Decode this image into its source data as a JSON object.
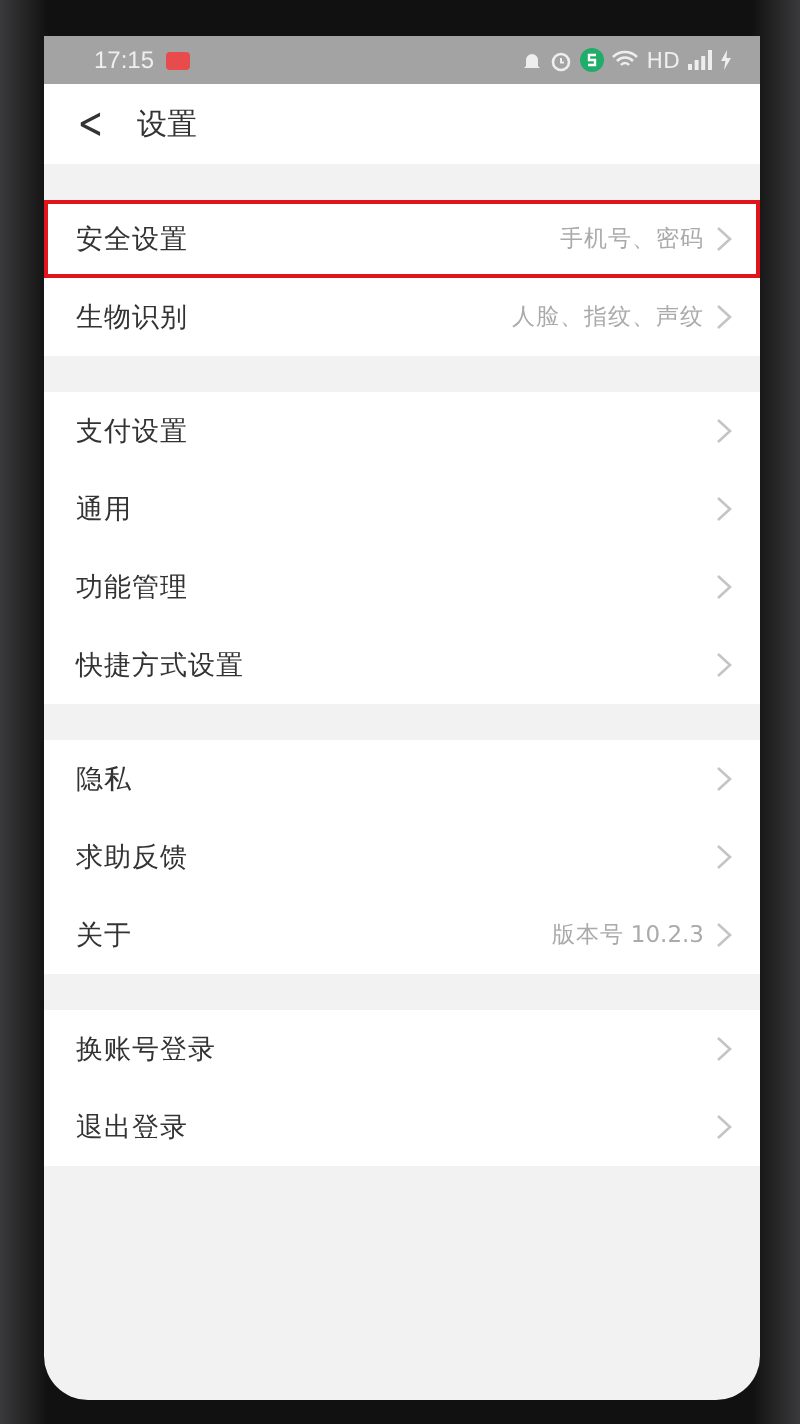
{
  "status_bar": {
    "time": "17:15",
    "network": "HD"
  },
  "header": {
    "back": "<",
    "title": "设置"
  },
  "groups": [
    {
      "items": [
        {
          "label": "安全设置",
          "detail": "手机号、密码",
          "highlighted": true
        },
        {
          "label": "生物识别",
          "detail": "人脸、指纹、声纹",
          "highlighted": false
        }
      ]
    },
    {
      "items": [
        {
          "label": "支付设置",
          "highlighted": false
        },
        {
          "label": "通用",
          "highlighted": false
        },
        {
          "label": "功能管理",
          "highlighted": false
        },
        {
          "label": "快捷方式设置",
          "highlighted": false
        }
      ]
    },
    {
      "items": [
        {
          "label": "隐私",
          "highlighted": false
        },
        {
          "label": "求助反馈",
          "highlighted": false
        },
        {
          "label": "关于",
          "detail": "版本号 10.2.3",
          "highlighted": false
        }
      ]
    },
    {
      "items": [
        {
          "label": "换账号登录",
          "highlighted": false
        },
        {
          "label": "退出登录",
          "highlighted": false
        }
      ]
    }
  ]
}
